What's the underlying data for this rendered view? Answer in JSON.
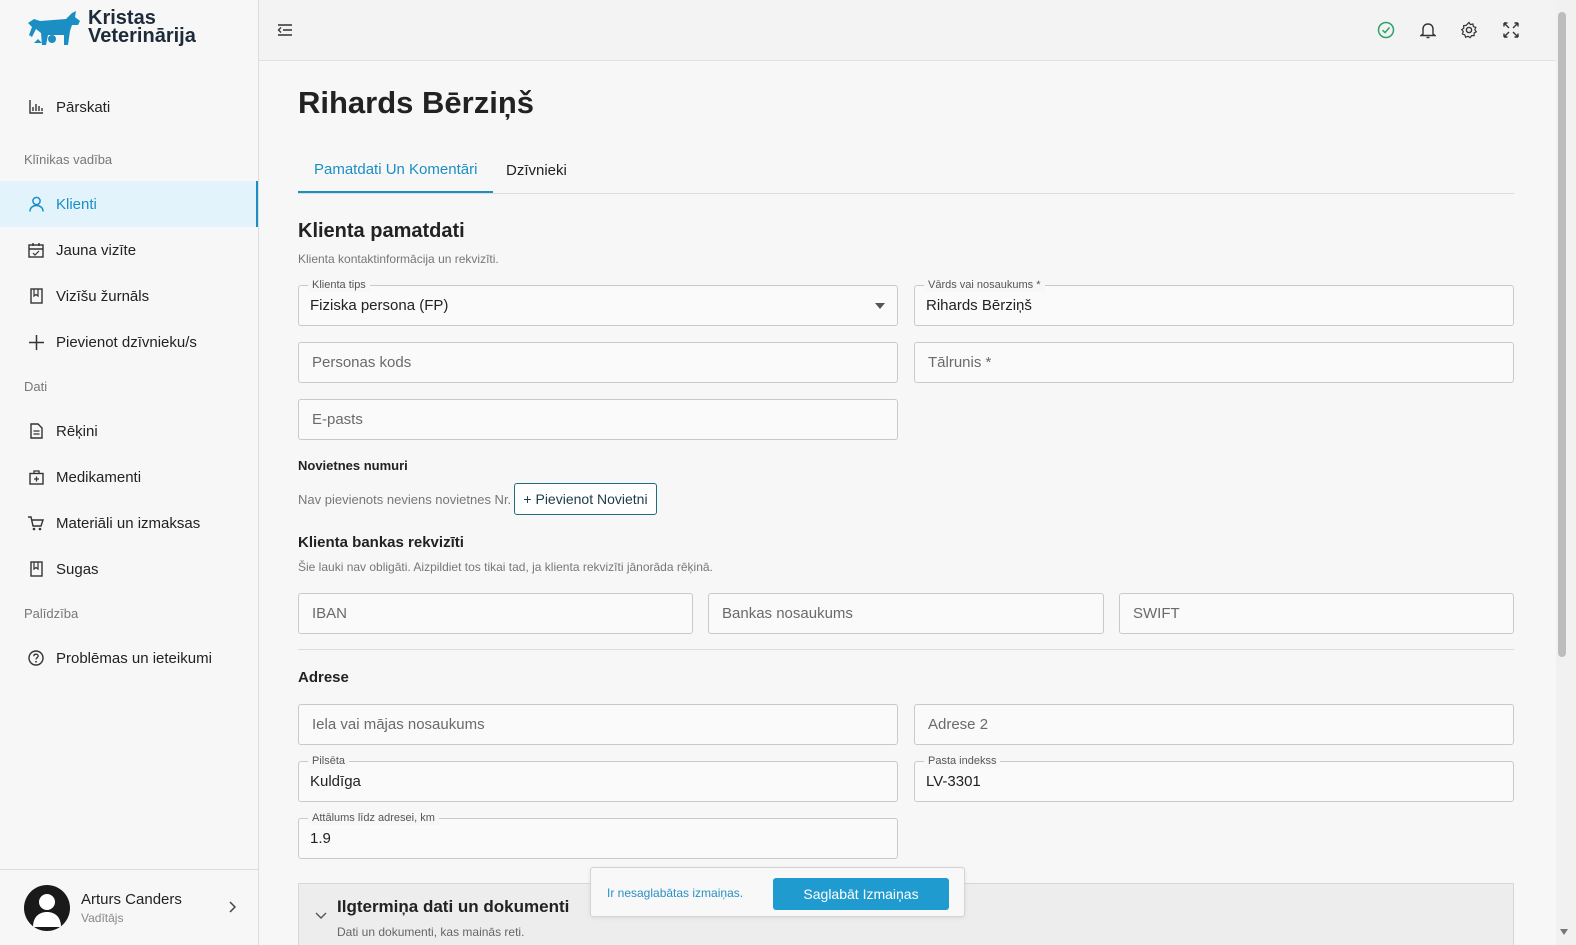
{
  "brand": {
    "line1": "Kristas",
    "line2": "Veterinārija",
    "color": "#1b8fc4"
  },
  "sidebar": {
    "top_item": {
      "label": "Pārskati",
      "icon": "bar-chart-icon"
    },
    "sections": [
      "Klīnikas vadība",
      "Dati",
      "Palīdzība"
    ],
    "clinic_items": [
      {
        "label": "Klienti",
        "icon": "user-icon",
        "active": true
      },
      {
        "label": "Jauna vizīte",
        "icon": "calendar-icon"
      },
      {
        "label": "Vizīšu žurnāls",
        "icon": "book-icon"
      },
      {
        "label": "Pievienot dzīvnieku/s",
        "icon": "plus-icon"
      }
    ],
    "data_items": [
      {
        "label": "Rēķini",
        "icon": "document-icon"
      },
      {
        "label": "Medikamenti",
        "icon": "medical-kit-icon"
      },
      {
        "label": "Materiāli un izmaksas",
        "icon": "cart-icon"
      },
      {
        "label": "Sugas",
        "icon": "book-icon"
      }
    ],
    "help_items": [
      {
        "label": "Problēmas un ieteikumi",
        "icon": "help-circle-icon"
      }
    ]
  },
  "user": {
    "name": "Arturs Canders",
    "role": "Vadītājs"
  },
  "page": {
    "title": "Rihards Bērziņš",
    "tabs": [
      "Pamatdati Un Komentāri",
      "Dzīvnieki"
    ]
  },
  "client": {
    "section_title": "Klienta pamatdati",
    "section_hint": "Klienta kontaktinformācija un rekvizīti.",
    "type_label": "Klienta tips",
    "type_value": "Fiziska persona (FP)",
    "name_label": "Vārds vai nosaukums *",
    "name_value": "Rihards Bērziņš",
    "personal_code_placeholder": "Personas kods",
    "phone_placeholder": "Tālrunis *",
    "email_placeholder": "E-pasts"
  },
  "premises": {
    "title": "Novietnes numuri",
    "empty_text": "Nav pievienots neviens novietnes Nr.",
    "add_button": "+ Pievienot Novietni"
  },
  "bank": {
    "title": "Klienta bankas rekvizīti",
    "hint": "Šie lauki nav obligāti. Aizpildiet tos tikai tad, ja klienta rekvizīti jānorāda rēķinā.",
    "iban_placeholder": "IBAN",
    "bank_name_placeholder": "Bankas nosaukums",
    "swift_placeholder": "SWIFT"
  },
  "address": {
    "title": "Adrese",
    "street_placeholder": "Iela vai mājas nosaukums",
    "address2_placeholder": "Adrese 2",
    "city_label": "Pilsēta",
    "city_value": "Kuldīga",
    "postal_label": "Pasta indekss",
    "postal_value": "LV-3301",
    "distance_label": "Attālums līdz adresei, km",
    "distance_value": "1.9"
  },
  "longterm": {
    "title": "Ilgtermiņa dati un dokumenti",
    "subtitle": "Dati un dokumenti, kas mainās reti."
  },
  "savebar": {
    "text": "Ir nesaglabātas izmaiņas.",
    "button": "Saglabāt Izmaiņas"
  }
}
